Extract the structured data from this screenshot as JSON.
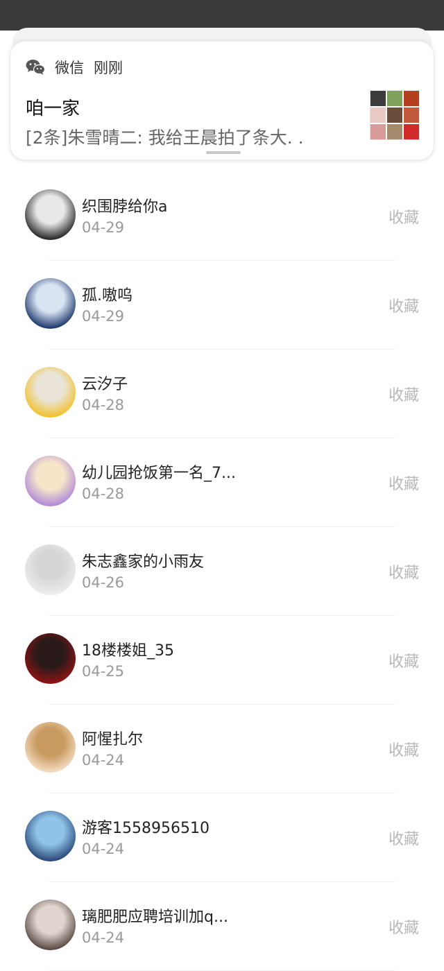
{
  "notification": {
    "app_name": "微信",
    "time": "刚刚",
    "title": "咱一家",
    "body": "[2条]朱雪晴二: 我给王晨拍了条大. .",
    "icon": "wechat-icon",
    "thumbnail": "photo-grid-thumbnail"
  },
  "list": {
    "items": [
      {
        "name": "织围脖给你a",
        "date": "04-29",
        "action": "收藏",
        "avatar_colors": [
          "#2a2a2a",
          "#e8e8e8"
        ]
      },
      {
        "name": "孤.嗷呜",
        "date": "04-29",
        "action": "收藏",
        "avatar_colors": [
          "#1f3a6e",
          "#d9e4f2"
        ]
      },
      {
        "name": "云汐子",
        "date": "04-28",
        "action": "收藏",
        "avatar_colors": [
          "#f2c230",
          "#e9e4d7"
        ]
      },
      {
        "name": "幼儿园抢饭第一名_7...",
        "date": "04-28",
        "action": "收藏",
        "avatar_colors": [
          "#b28ad8",
          "#f6e5c9"
        ]
      },
      {
        "name": "朱志鑫家的小雨友",
        "date": "04-26",
        "action": "收藏",
        "avatar_colors": [
          "#ececec",
          "#d6d6d6"
        ]
      },
      {
        "name": "18楼楼姐_35",
        "date": "04-25",
        "action": "收藏",
        "avatar_colors": [
          "#8b1414",
          "#2a1a1a"
        ]
      },
      {
        "name": "阿惺扎尔",
        "date": "04-24",
        "action": "收藏",
        "avatar_colors": [
          "#f4dcc0",
          "#c89a60"
        ]
      },
      {
        "name": "游客1558956510",
        "date": "04-24",
        "action": "收藏",
        "avatar_colors": [
          "#2b4a7a",
          "#8fc3e8"
        ]
      },
      {
        "name": "璃肥肥应聘培训加q...",
        "date": "04-24",
        "action": "收藏",
        "avatar_colors": [
          "#5a4a44",
          "#e0d6cf"
        ]
      }
    ]
  },
  "colors": {
    "status_bar": "#3a3a3a",
    "name_text": "#222222",
    "date_text": "#999999",
    "action_text": "#b8b8b8"
  }
}
